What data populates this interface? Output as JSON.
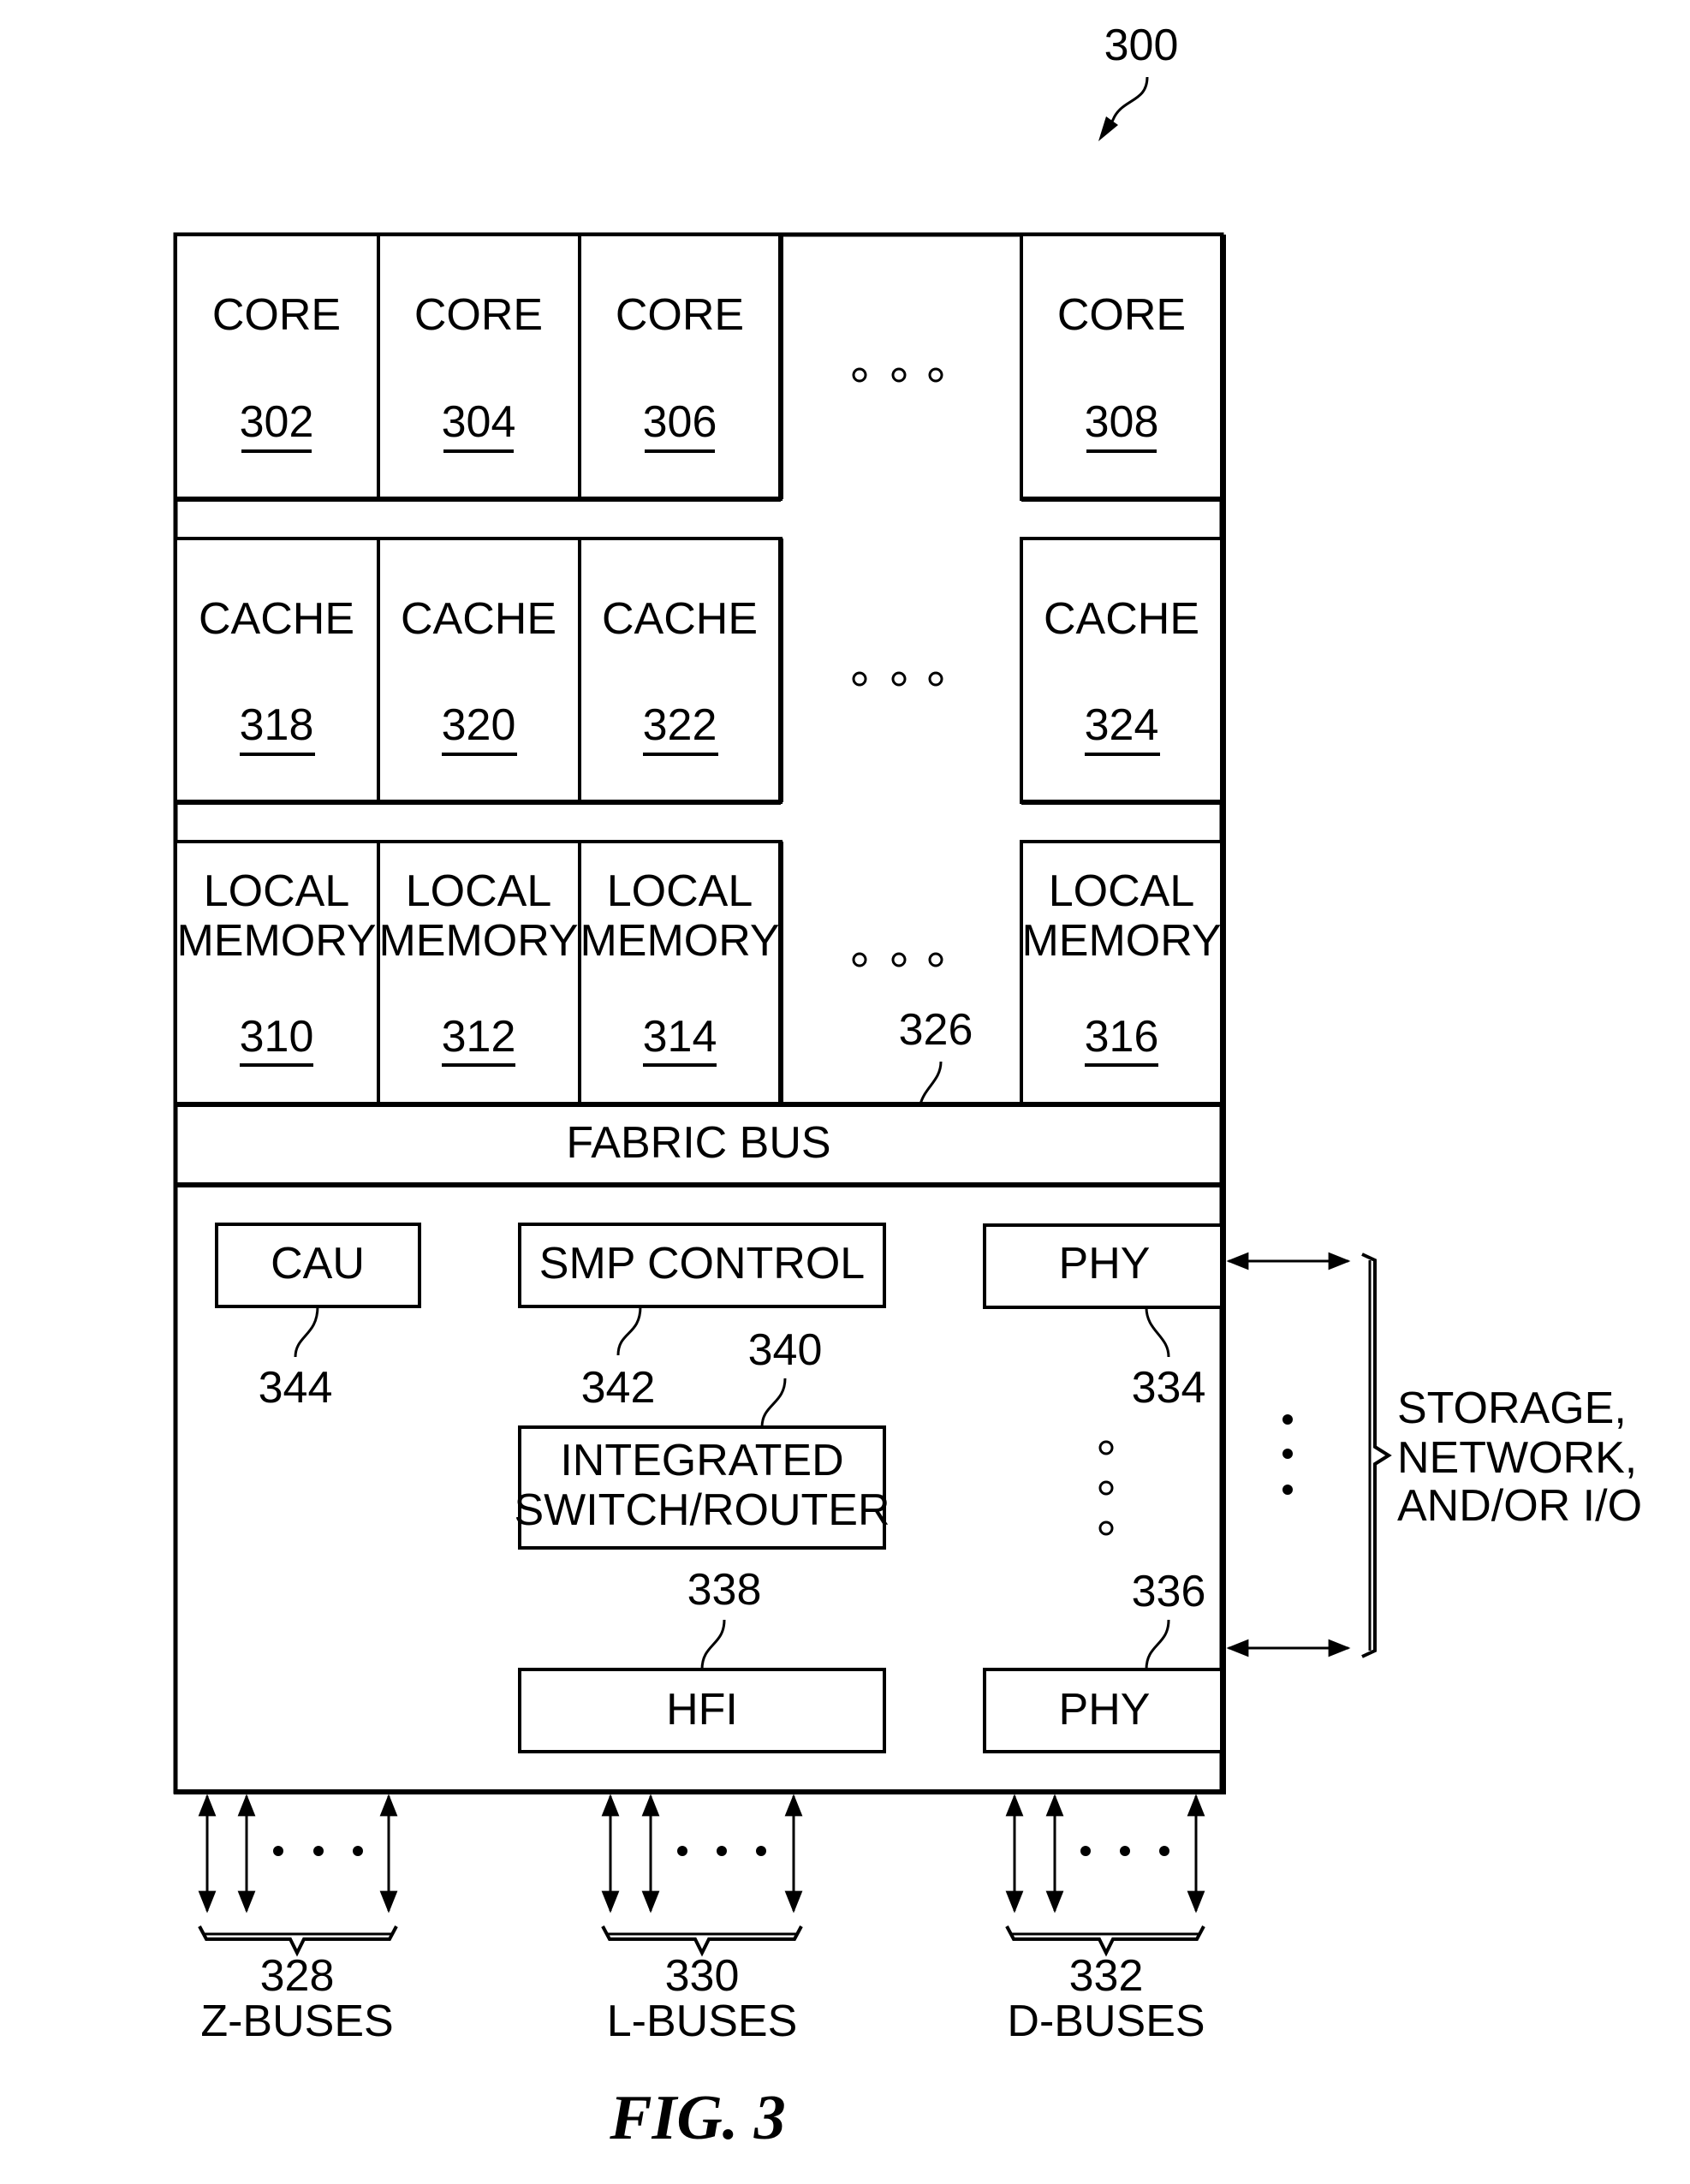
{
  "figure": {
    "ref": "300",
    "caption": "FIG. 3"
  },
  "cores": [
    {
      "label": "CORE",
      "ref": "302"
    },
    {
      "label": "CORE",
      "ref": "304"
    },
    {
      "label": "CORE",
      "ref": "306"
    },
    {
      "label": "CORE",
      "ref": "308"
    }
  ],
  "caches": [
    {
      "label": "CACHE",
      "ref": "318"
    },
    {
      "label": "CACHE",
      "ref": "320"
    },
    {
      "label": "CACHE",
      "ref": "322"
    },
    {
      "label": "CACHE",
      "ref": "324"
    }
  ],
  "memories": [
    {
      "line1": "LOCAL",
      "line2": "MEMORY",
      "ref": "310"
    },
    {
      "line1": "LOCAL",
      "line2": "MEMORY",
      "ref": "312"
    },
    {
      "line1": "LOCAL",
      "line2": "MEMORY",
      "ref": "314"
    },
    {
      "line1": "LOCAL",
      "line2": "MEMORY",
      "ref": "316"
    }
  ],
  "fabric_bus": {
    "label": "FABRIC BUS",
    "ref": "326"
  },
  "components": {
    "cau": {
      "label": "CAU",
      "ref": "344"
    },
    "smp": {
      "label": "SMP CONTROL",
      "ref": "342"
    },
    "switch": {
      "line1": "INTEGRATED",
      "line2": "SWITCH/ROUTER",
      "ref": "340"
    },
    "hfi": {
      "label": "HFI",
      "ref": "338"
    },
    "phy_top": {
      "label": "PHY",
      "ref": "334"
    },
    "phy_bottom": {
      "label": "PHY",
      "ref": "336"
    }
  },
  "external": {
    "line1": "STORAGE,",
    "line2": "NETWORK,",
    "line3": "AND/OR I/O"
  },
  "buses": [
    {
      "ref": "328",
      "label": "Z-BUSES"
    },
    {
      "ref": "330",
      "label": "L-BUSES"
    },
    {
      "ref": "332",
      "label": "D-BUSES"
    }
  ]
}
